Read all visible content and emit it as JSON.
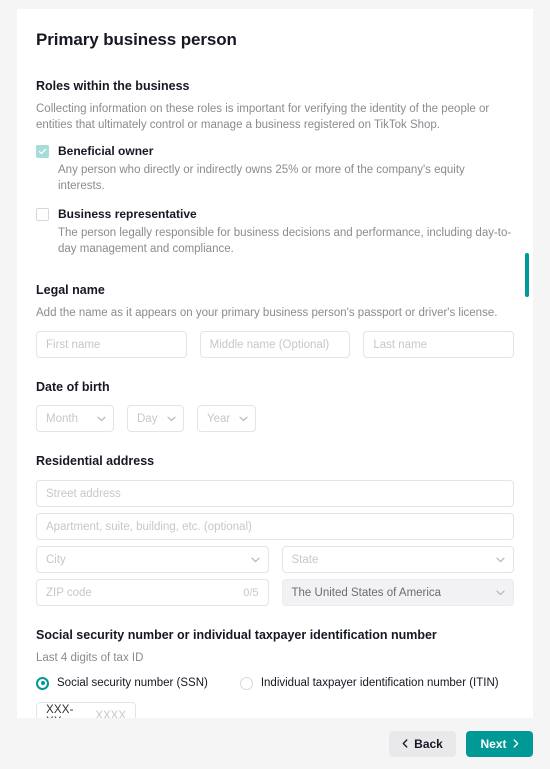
{
  "page": {
    "title": "Primary business person"
  },
  "roles": {
    "heading": "Roles within the business",
    "description": "Collecting information on these roles is important for verifying the identity of the people or entities that ultimately control or manage a business registered on TikTok Shop.",
    "options": [
      {
        "label": "Beneficial owner",
        "sub": "Any person who directly or indirectly owns 25% or more of the company's equity interests.",
        "checked": true
      },
      {
        "label": "Business representative",
        "sub": "The person legally responsible for business decisions and performance, including day-to-day management and compliance.",
        "checked": false
      }
    ]
  },
  "legal_name": {
    "heading": "Legal name",
    "description": "Add the name as it appears on your primary business person's passport or driver's license.",
    "first_placeholder": "First name",
    "first_value": "",
    "middle_placeholder": "Middle name (Optional)",
    "middle_value": "",
    "last_placeholder": "Last name",
    "last_value": ""
  },
  "date_of_birth": {
    "heading": "Date of birth",
    "month_placeholder": "Month",
    "month_value": "",
    "day_placeholder": "Day",
    "day_value": "",
    "year_placeholder": "Year",
    "year_value": ""
  },
  "residential_address": {
    "heading": "Residential address",
    "street_placeholder": "Street address",
    "street_value": "",
    "apartment_placeholder": "Apartment, suite, building, etc. (optional)",
    "apartment_value": "",
    "city_placeholder": "City",
    "city_value": "",
    "state_placeholder": "State",
    "state_value": "",
    "zip_placeholder": "ZIP code",
    "zip_value": "",
    "zip_counter": "0/5",
    "country_value": "The United States of America"
  },
  "tax_id": {
    "heading": "Social security number or individual taxpayer identification number",
    "helper": "Last 4 digits of tax ID",
    "ssn_option": "Social security number (SSN)",
    "itin_option": "Individual taxpayer identification number (ITIN)",
    "selected": "ssn",
    "prefix": "XXX-XX-",
    "placeholder": "XXXX",
    "value": ""
  },
  "footer": {
    "back_label": "Back",
    "next_label": "Next"
  },
  "colors": {
    "accent": "#009995",
    "checkbox_checked": "#a8dcd8",
    "page_background": "#f5f5f5",
    "card_background": "#ffffff",
    "text_primary": "#161823",
    "text_muted": "#8a8b91",
    "placeholder": "#c6c7cc",
    "back_button": "#e9e9ec"
  }
}
